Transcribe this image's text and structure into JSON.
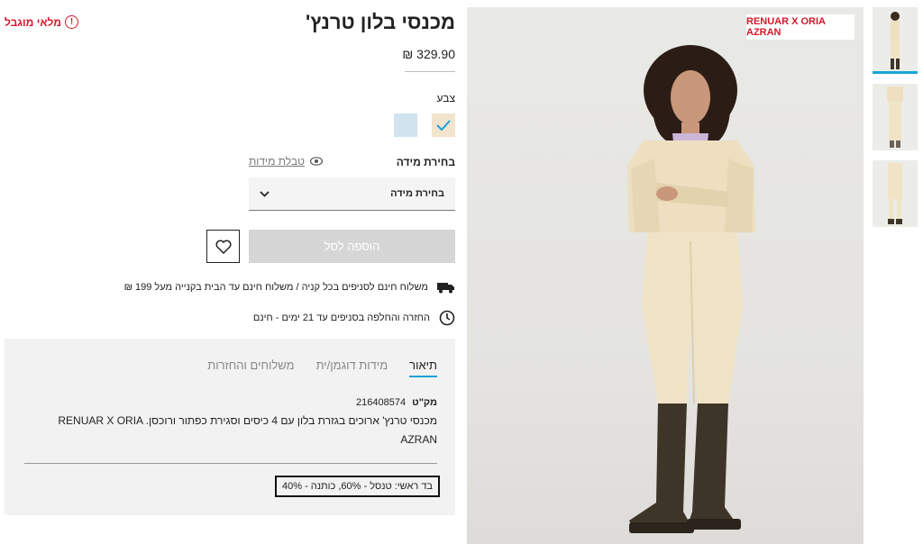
{
  "product": {
    "title": "מכנסי בלון טרנץ'",
    "price": "329.90 ₪",
    "stock_status": "מלאי מוגבל",
    "stock_icon": "alert-circle-icon"
  },
  "color": {
    "label": "צבע",
    "swatches": [
      {
        "name": "cream",
        "hex": "#f3e4cd",
        "selected": true
      },
      {
        "name": "light-blue",
        "hex": "#d0e3ee",
        "selected": false
      }
    ]
  },
  "size": {
    "label": "בחירת מידה",
    "table_link": "טבלת מידות",
    "select_value": "בחירת מידה"
  },
  "actions": {
    "add_to_cart": "הוספה לסל"
  },
  "perks": {
    "shipping": "משלוח חינם לסניפים בכל קניה / משלוח חינם עד הבית בקנייה מעל 199 ₪",
    "returns": "החזרה והחלפה בסניפים עד 21 ימים - חינם"
  },
  "details": {
    "tabs": [
      "תיאור",
      "מידות דוגמן/ית",
      "משלוחים והחזרות"
    ],
    "sku_label": "מק\"ט",
    "sku_value": "216408574",
    "description": "מכנסי טרנץ' ארוכים בגזרת בלון עם 4 כיסים וסגירת כפתור ורוכסן. RENUAR X ORIA AZRAN",
    "fabric": "בד ראשי: טנסל - 60%, כותנה - 40%"
  },
  "gallery": {
    "brand_tag": "RENUAR X ORIA AZRAN",
    "thumbnail_count": 3
  },
  "colors": {
    "accent": "#1aa3d8",
    "alert": "#d2182a",
    "disabled_button": "#d6d6d6"
  }
}
